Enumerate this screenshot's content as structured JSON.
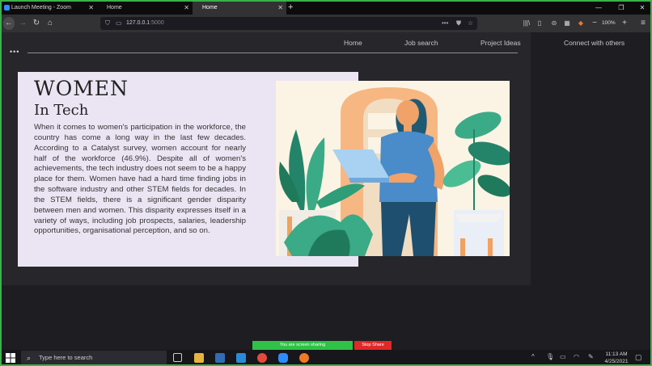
{
  "browser": {
    "tabs": [
      {
        "title": "Launch Meeting - Zoom",
        "active": false
      },
      {
        "title": "Home",
        "active": false
      },
      {
        "title": "Home",
        "active": true
      }
    ],
    "url_host": "127.0.0.1",
    "url_port": ":5000",
    "zoom_level": "100%"
  },
  "site": {
    "nav": [
      "Home",
      "Job search",
      "Project Ideas",
      "Connect with others"
    ],
    "menu_dots": "•••",
    "hero": {
      "title": "WOMEN",
      "subtitle": "In Tech",
      "paragraph": "When it comes to women's participation in the workforce, the country has come a long way in the last few decades. According to a Catalyst survey, women account for nearly half of the workforce (46.9%). Despite all of women's achievements, the tech industry does not seem to be a happy place for them. Women have had a hard time finding jobs in the software industry and other STEM fields for decades. In the STEM fields, there is a significant gender disparity between men and women. This disparity expresses itself in a variety of ways, including job prospects, salaries, leadership opportunities, organisational perception, and so on."
    }
  },
  "zoom_share": {
    "status": "You are screen sharing",
    "stop_label": "Stop Share"
  },
  "taskbar": {
    "search_placeholder": "Type here to search",
    "time": "11:13 AM",
    "date": "4/25/2021"
  },
  "colors": {
    "border": "#3bb24a",
    "card_bg": "#ebe5f3",
    "page_bg": "#26262b",
    "stop_share": "#e02828"
  }
}
